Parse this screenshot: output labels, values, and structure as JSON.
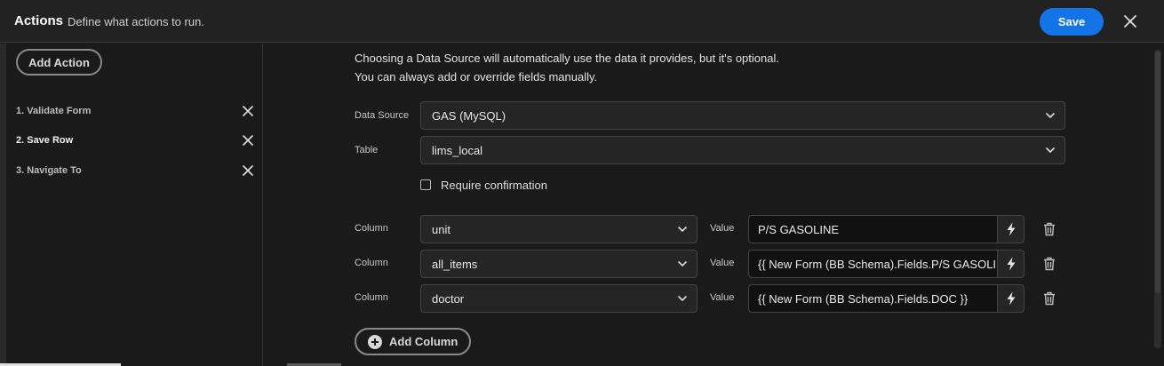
{
  "header": {
    "title": "Actions",
    "subtitle": "Define what actions to run.",
    "save_label": "Save",
    "close_icon": "close-icon"
  },
  "sidebar": {
    "add_action_label": "Add Action",
    "actions": [
      {
        "label": "1. Validate Form",
        "selected": false
      },
      {
        "label": "2. Save Row",
        "selected": true
      },
      {
        "label": "3. Navigate To",
        "selected": false
      }
    ]
  },
  "main": {
    "info_line1": "Choosing a Data Source will automatically use the data it provides, but it's optional.",
    "info_line2": "You can always add or override fields manually.",
    "data_source": {
      "label": "Data Source",
      "value": "GAS (MySQL)"
    },
    "table": {
      "label": "Table",
      "value": "lims_local"
    },
    "require_confirmation": {
      "label": "Require confirmation",
      "checked": false
    },
    "columns": [
      {
        "column_label": "Column",
        "column": "unit",
        "value_label": "Value",
        "value": "P/S GASOLINE"
      },
      {
        "column_label": "Column",
        "column": "all_items",
        "value_label": "Value",
        "value": "{{ New Form (BB Schema).Fields.P/S GASOLINE }}"
      },
      {
        "column_label": "Column",
        "column": "doctor",
        "value_label": "Value",
        "value": "{{ New Form (BB Schema).Fields.DOC }}"
      }
    ],
    "add_column_label": "Add Column"
  },
  "colors": {
    "accent": "#1473e6",
    "background": "#1a1a1a",
    "header_bg": "#222222"
  }
}
